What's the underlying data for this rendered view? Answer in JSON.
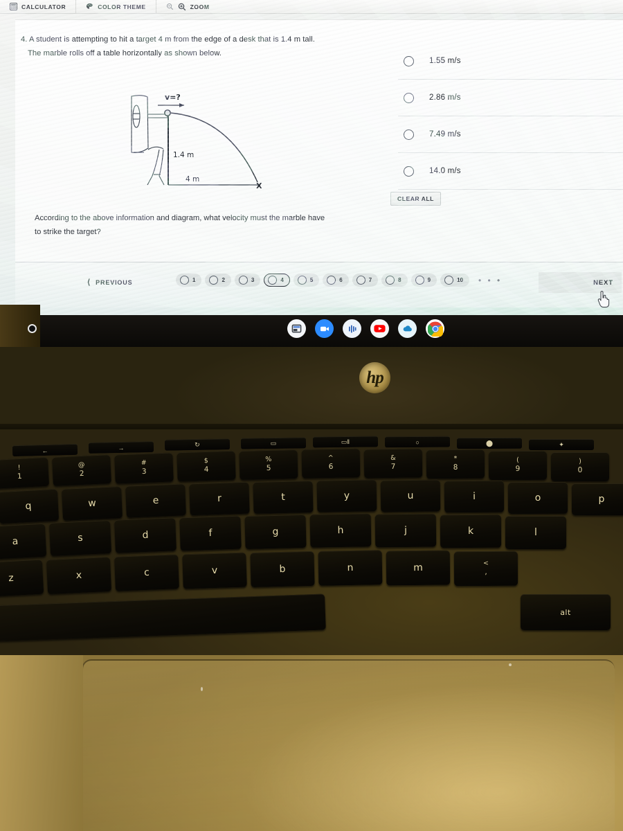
{
  "toolbar": {
    "calculator_label": "CALCULATOR",
    "calculator_icon": "calculator-icon",
    "color_theme_label": "COLOR THEME",
    "color_theme_icon": "palette-icon",
    "zoom_label": "ZOOM",
    "zoom_out_icon": "magnifier-minus-icon",
    "zoom_in_icon": "magnifier-plus-icon"
  },
  "question": {
    "number": "4.",
    "line1": "4. A student is attempting to hit a target 4 m from the edge of a desk that is 1.4 m tall.",
    "line2": "The marble rolls off a table horizontally as shown below.",
    "prompt_line1": "According to the above information and diagram, what velocity must the marble have",
    "prompt_line2": "to strike the target?"
  },
  "diagram": {
    "velocity_label": "v=?",
    "height_label": "1.4 m",
    "distance_label": "4 m",
    "target_label": "X"
  },
  "answers": {
    "choices": [
      {
        "label": "1.55 m/s",
        "selected": false
      },
      {
        "label": "2.86 m/s",
        "selected": false
      },
      {
        "label": "7.49 m/s",
        "selected": false
      },
      {
        "label": "14.0 m/s",
        "selected": false
      }
    ],
    "clear_all_label": "CLEAR ALL"
  },
  "nav": {
    "previous_label": "PREVIOUS",
    "previous_icon": "chevron-left-icon",
    "next_label": "NEXT",
    "ellipsis": "• • •",
    "questions": [
      "1",
      "2",
      "3",
      "4",
      "5",
      "6",
      "7",
      "8",
      "9",
      "10"
    ],
    "active_question": "4"
  },
  "taskbar": {
    "icons": [
      {
        "name": "files-window-icon",
        "color": "#ffffff"
      },
      {
        "name": "zoom-video-icon",
        "color": "#2d8cff"
      },
      {
        "name": "audio-app-icon",
        "color": "#f3f6fa"
      },
      {
        "name": "youtube-icon",
        "color": "#ff0000"
      },
      {
        "name": "cloud-app-icon",
        "color": "#e8f6fb"
      },
      {
        "name": "chrome-icon",
        "color": "#4285f4"
      }
    ]
  },
  "laptop": {
    "brand": "hp",
    "power_led": "power-led-indicator"
  },
  "keyboard": {
    "function_row": [
      {
        "glyph": "←",
        "name": "back-key"
      },
      {
        "glyph": "→",
        "name": "forward-key"
      },
      {
        "glyph": "↻",
        "name": "reload-key"
      },
      {
        "glyph": "▭",
        "name": "fullscreen-key"
      },
      {
        "glyph": "▭‖",
        "name": "overview-key"
      },
      {
        "glyph": "○",
        "name": "brightness-down-key"
      },
      {
        "glyph": "⬤",
        "name": "brightness-up-key"
      },
      {
        "glyph": "✦",
        "name": "mute-key"
      }
    ],
    "number_row": [
      {
        "sym": "!",
        "dig": "1"
      },
      {
        "sym": "@",
        "dig": "2"
      },
      {
        "sym": "#",
        "dig": "3"
      },
      {
        "sym": "$",
        "dig": "4"
      },
      {
        "sym": "%",
        "dig": "5"
      },
      {
        "sym": "^",
        "dig": "6"
      },
      {
        "sym": "&",
        "dig": "7"
      },
      {
        "sym": "*",
        "dig": "8"
      },
      {
        "sym": "(",
        "dig": "9"
      },
      {
        "sym": ")",
        "dig": "0"
      }
    ],
    "row_q": [
      "q",
      "w",
      "e",
      "r",
      "t",
      "y",
      "u",
      "i",
      "o",
      "p"
    ],
    "row_a": [
      "a",
      "s",
      "d",
      "f",
      "g",
      "h",
      "j",
      "k",
      "l"
    ],
    "row_z": [
      "z",
      "x",
      "c",
      "v",
      "b",
      "n",
      "m",
      "<"
    ],
    "comma_key": ",",
    "alt_key": "alt"
  }
}
